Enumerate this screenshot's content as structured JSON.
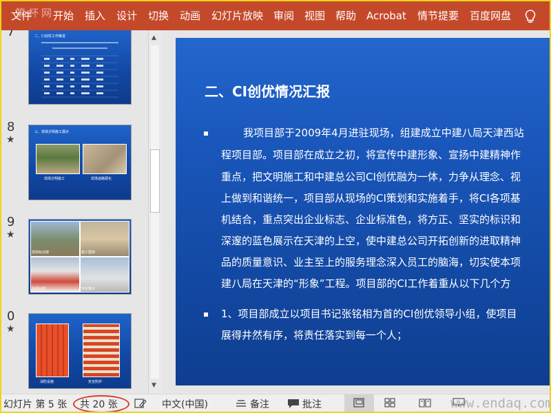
{
  "ribbon": {
    "watermark": "第杯网",
    "tabs": [
      "文件",
      "开始",
      "插入",
      "设计",
      "切换",
      "动画",
      "幻灯片放映",
      "审阅",
      "视图",
      "帮助",
      "Acrobat",
      "情节提要",
      "百度网盘"
    ]
  },
  "thumbnails": [
    {
      "number": "7",
      "starred": false,
      "title": "二、CI创优工作推进",
      "photo_labels": []
    },
    {
      "number": "8",
      "starred": true,
      "title": "三、现场文明施工展示",
      "photo_labels": [
        "现场文明施工",
        "现场道路硬化"
      ]
    },
    {
      "number": "9",
      "starred": true,
      "title": "",
      "photo_labels": [
        "现场标识牌",
        "施工围挡",
        "标语标牌",
        "安全警示"
      ]
    },
    {
      "number": "0",
      "starred": true,
      "title": "",
      "photo_labels": [
        "消防设施",
        "安全防护"
      ]
    }
  ],
  "slide": {
    "title": "二、CI创优情况汇报",
    "paragraph1": [
      "我项目部于2009年4月进驻现场，组建成立中建八局天津西站",
      "程项目部。项目部在成立之初，将宣传中建形象、宣扬中建精神作",
      "重点，把文明施工和中建总公司CI创优融为一体，力争从理念、视",
      "上做到和谐统一，项目部从现场的CI策划和实施着手，将CI各项基",
      "机结合，重点突出企业标志、企业标准色，将方正、坚实的标识和",
      "深邃的蓝色展示在天津的上空，使中建总公司开拓创新的进取精神",
      "品的质量意识、业主至上的服务理念深入员工的脑海，切实使本项",
      "建八局在天津的“形象”工程。项目部的CI工作着重从以下几个方"
    ],
    "paragraph2": [
      "1、项目部成立以项目书记张铭相为首的CI创优领导小组，使项目",
      "展得井然有序，将责任落实到每一个人；"
    ]
  },
  "status": {
    "slide_label": "幻灯片 第 5 张",
    "total_label": "共 20 张",
    "language": "中文(中国)",
    "notes_label": "备注",
    "comments_label": "批注",
    "watermark": "www.endaq.com"
  },
  "colors": {
    "ribbon": "#c4492a",
    "slide_top": "#2366cd",
    "slide_bottom": "#0f3e90",
    "highlight_circle": "#d83a2e"
  }
}
